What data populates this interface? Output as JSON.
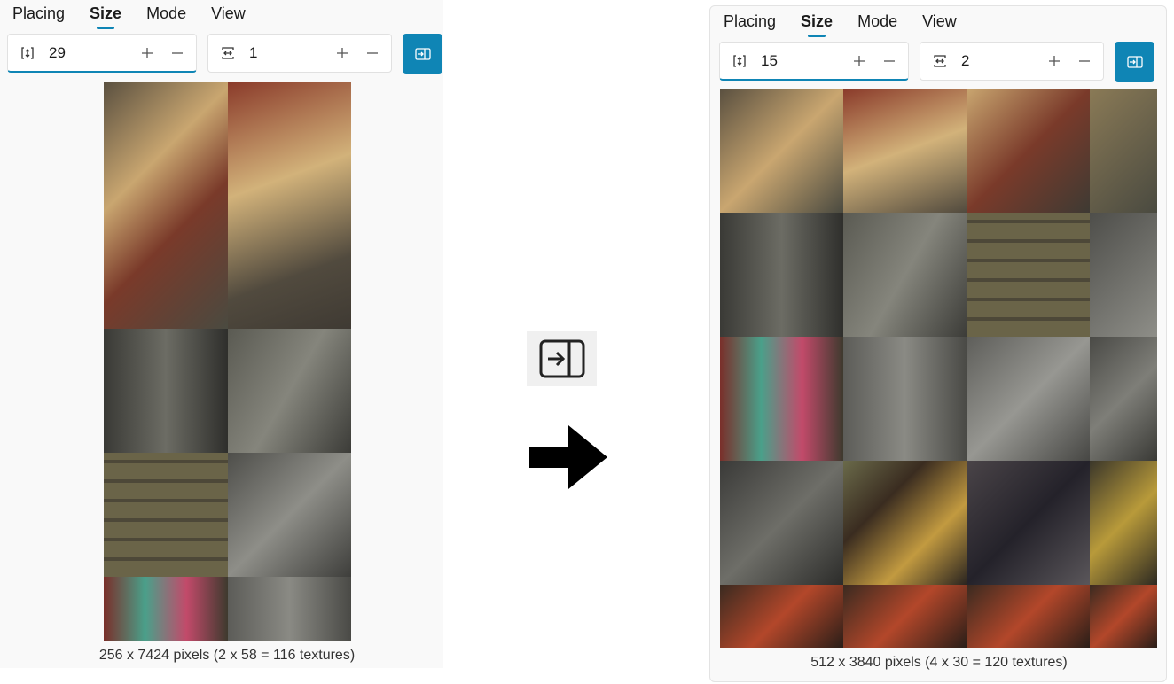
{
  "colors": {
    "accent": "#0f85b5",
    "panel_bg": "#f9f9f9"
  },
  "left": {
    "tabs": [
      "Placing",
      "Size",
      "Mode",
      "View"
    ],
    "active_tab": "Size",
    "rows_value": "29",
    "cols_value": "1",
    "caption": "256 x 7424 pixels (2 x 58 = 116 textures)"
  },
  "right": {
    "tabs": [
      "Placing",
      "Size",
      "Mode",
      "View"
    ],
    "active_tab": "Size",
    "rows_value": "15",
    "cols_value": "2",
    "caption": "512 x 3840 pixels (4 x 30 = 120 textures)"
  },
  "icons": {
    "rows": "vertical-resize-icon",
    "cols": "horizontal-resize-icon",
    "plus": "plus-icon",
    "minus": "minus-icon",
    "apply": "apply-size-icon",
    "arrow": "right-arrow-icon"
  }
}
